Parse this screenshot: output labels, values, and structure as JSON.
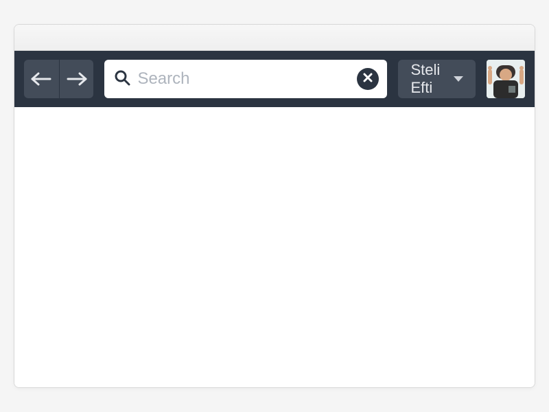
{
  "search": {
    "placeholder": "Search",
    "value": ""
  },
  "user": {
    "name": "Steli Efti"
  }
}
